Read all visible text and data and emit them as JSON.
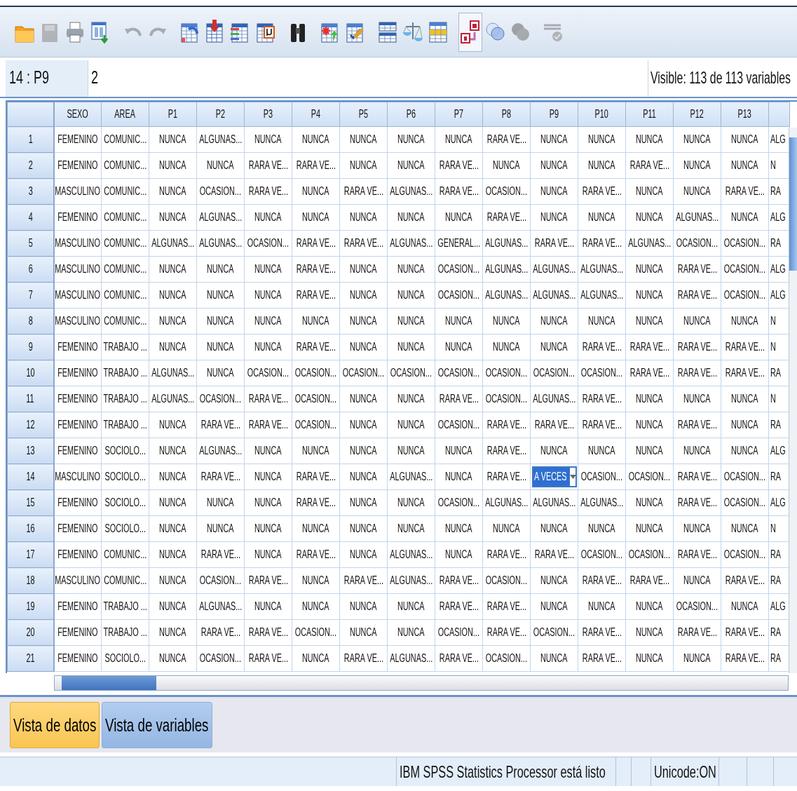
{
  "toolbar": [
    {
      "disabled": false,
      "pressed": false
    },
    {
      "disabled": true,
      "pressed": false
    },
    {
      "disabled": false,
      "pressed": false
    },
    {
      "disabled": false,
      "pressed": false
    },
    {
      "disabled": true,
      "pressed": false
    },
    {
      "disabled": true,
      "pressed": false
    },
    {
      "disabled": false,
      "pressed": false
    },
    {
      "disabled": false,
      "pressed": false
    },
    {
      "disabled": false,
      "pressed": false
    },
    {
      "disabled": false,
      "pressed": false
    },
    {
      "disabled": false,
      "pressed": false
    },
    {
      "disabled": false,
      "pressed": false
    },
    {
      "disabled": false,
      "pressed": false
    },
    {
      "disabled": false,
      "pressed": false
    },
    {
      "disabled": false,
      "pressed": false
    },
    {
      "disabled": false,
      "pressed": false
    },
    {
      "disabled": false,
      "pressed": true
    },
    {
      "disabled": false,
      "pressed": false
    },
    {
      "disabled": true,
      "pressed": false
    },
    {
      "disabled": true,
      "pressed": false
    }
  ],
  "cell_ref": "14 : P9",
  "cell_value": "2",
  "visible_info": "Visible: 113 de 113 variables",
  "columns": [
    "SEXO",
    "AREA",
    "P1",
    "P2",
    "P3",
    "P4",
    "P5",
    "P6",
    "P7",
    "P8",
    "P9",
    "P10",
    "P11",
    "P12",
    "P13"
  ],
  "rows": [
    {
      "number": "1",
      "cells": [
        "FEMENINO",
        "COMUNIC...",
        "NUNCA",
        "ALGUNAS...",
        "NUNCA",
        "NUNCA",
        "NUNCA",
        "NUNCA",
        "NUNCA",
        "RARA VE...",
        "NUNCA",
        "NUNCA",
        "NUNCA",
        "NUNCA",
        "NUNCA",
        "ALG"
      ]
    },
    {
      "number": "2",
      "cells": [
        "FEMENINO",
        "COMUNIC...",
        "NUNCA",
        "NUNCA",
        "RARA VE...",
        "RARA VE...",
        "NUNCA",
        "NUNCA",
        "RARA VE...",
        "NUNCA",
        "NUNCA",
        "NUNCA",
        "RARA VE...",
        "NUNCA",
        "NUNCA",
        "N"
      ]
    },
    {
      "number": "3",
      "cells": [
        "MASCULINO",
        "COMUNIC...",
        "NUNCA",
        "OCASION...",
        "RARA VE...",
        "NUNCA",
        "RARA VE...",
        "ALGUNAS...",
        "RARA VE...",
        "OCASION...",
        "NUNCA",
        "RARA VE...",
        "NUNCA",
        "NUNCA",
        "RARA VE...",
        "RA"
      ]
    },
    {
      "number": "4",
      "cells": [
        "FEMENINO",
        "COMUNIC...",
        "NUNCA",
        "ALGUNAS...",
        "NUNCA",
        "NUNCA",
        "NUNCA",
        "NUNCA",
        "NUNCA",
        "RARA VE...",
        "NUNCA",
        "NUNCA",
        "NUNCA",
        "ALGUNAS...",
        "NUNCA",
        "ALG"
      ]
    },
    {
      "number": "5",
      "cells": [
        "MASCULINO",
        "COMUNIC...",
        "ALGUNAS...",
        "ALGUNAS...",
        "OCASION...",
        "RARA VE...",
        "RARA VE...",
        "ALGUNAS...",
        "GENERAL...",
        "ALGUNAS...",
        "RARA VE...",
        "RARA VE...",
        "ALGUNAS...",
        "OCASION...",
        "OCASION...",
        "RA"
      ]
    },
    {
      "number": "6",
      "cells": [
        "MASCULINO",
        "COMUNIC...",
        "NUNCA",
        "NUNCA",
        "NUNCA",
        "RARA VE...",
        "NUNCA",
        "NUNCA",
        "OCASION...",
        "ALGUNAS...",
        "ALGUNAS...",
        "ALGUNAS...",
        "NUNCA",
        "RARA VE...",
        "OCASION...",
        "ALG"
      ]
    },
    {
      "number": "7",
      "cells": [
        "MASCULINO",
        "COMUNIC...",
        "NUNCA",
        "NUNCA",
        "NUNCA",
        "RARA VE...",
        "NUNCA",
        "NUNCA",
        "OCASION...",
        "ALGUNAS...",
        "ALGUNAS...",
        "ALGUNAS...",
        "NUNCA",
        "RARA VE...",
        "OCASION...",
        "ALG"
      ]
    },
    {
      "number": "8",
      "cells": [
        "MASCULINO",
        "COMUNIC...",
        "NUNCA",
        "NUNCA",
        "NUNCA",
        "NUNCA",
        "NUNCA",
        "NUNCA",
        "NUNCA",
        "NUNCA",
        "NUNCA",
        "NUNCA",
        "NUNCA",
        "NUNCA",
        "NUNCA",
        "N"
      ]
    },
    {
      "number": "9",
      "cells": [
        "FEMENINO",
        "TRABAJO ...",
        "NUNCA",
        "NUNCA",
        "NUNCA",
        "RARA VE...",
        "NUNCA",
        "NUNCA",
        "NUNCA",
        "NUNCA",
        "NUNCA",
        "RARA VE...",
        "RARA VE...",
        "RARA VE...",
        "RARA VE...",
        "N"
      ]
    },
    {
      "number": "10",
      "cells": [
        "FEMENINO",
        "TRABAJO ...",
        "ALGUNAS...",
        "NUNCA",
        "OCASION...",
        "OCASION...",
        "OCASION...",
        "OCASION...",
        "OCASION...",
        "OCASION...",
        "OCASION...",
        "OCASION...",
        "RARA VE...",
        "RARA VE...",
        "RARA VE...",
        "RA"
      ]
    },
    {
      "number": "11",
      "cells": [
        "FEMENINO",
        "TRABAJO ...",
        "ALGUNAS...",
        "OCASION...",
        "RARA VE...",
        "OCASION...",
        "NUNCA",
        "NUNCA",
        "RARA VE...",
        "OCASION...",
        "ALGUNAS...",
        "RARA VE...",
        "NUNCA",
        "NUNCA",
        "NUNCA",
        "N"
      ]
    },
    {
      "number": "12",
      "cells": [
        "FEMENINO",
        "TRABAJO ...",
        "NUNCA",
        "RARA VE...",
        "RARA VE...",
        "OCASION...",
        "NUNCA",
        "NUNCA",
        "OCASION...",
        "RARA VE...",
        "RARA VE...",
        "RARA VE...",
        "NUNCA",
        "RARA VE...",
        "NUNCA",
        "RA"
      ]
    },
    {
      "number": "13",
      "cells": [
        "FEMENINO",
        "SOCIOLO...",
        "NUNCA",
        "ALGUNAS...",
        "NUNCA",
        "NUNCA",
        "NUNCA",
        "NUNCA",
        "NUNCA",
        "RARA VE...",
        "NUNCA",
        "NUNCA",
        "NUNCA",
        "NUNCA",
        "NUNCA",
        "ALG"
      ]
    },
    {
      "number": "14",
      "cells": [
        "MASCULINO",
        "SOCIOLO...",
        "NUNCA",
        "RARA VE...",
        "NUNCA",
        "RARA VE...",
        "NUNCA",
        "ALGUNAS...",
        "NUNCA",
        "RARA VE...",
        {
          "kind": "editor",
          "value": "A VECES"
        },
        "OCASION...",
        "OCASION...",
        "RARA VE...",
        "OCASION...",
        "RA"
      ]
    },
    {
      "number": "15",
      "cells": [
        "FEMENINO",
        "SOCIOLO...",
        "NUNCA",
        "NUNCA",
        "NUNCA",
        "RARA VE...",
        "NUNCA",
        "NUNCA",
        "OCASION...",
        "ALGUNAS...",
        "ALGUNAS...",
        "ALGUNAS...",
        "NUNCA",
        "RARA VE...",
        "OCASION...",
        "ALG"
      ]
    },
    {
      "number": "16",
      "cells": [
        "FEMENINO",
        "SOCIOLO...",
        "NUNCA",
        "NUNCA",
        "NUNCA",
        "NUNCA",
        "NUNCA",
        "NUNCA",
        "NUNCA",
        "NUNCA",
        "NUNCA",
        "NUNCA",
        "NUNCA",
        "NUNCA",
        "NUNCA",
        "N"
      ]
    },
    {
      "number": "17",
      "cells": [
        "FEMENINO",
        "COMUNIC...",
        "NUNCA",
        "RARA VE...",
        "NUNCA",
        "RARA VE...",
        "NUNCA",
        "ALGUNAS...",
        "NUNCA",
        "RARA VE...",
        "RARA VE...",
        "OCASION...",
        "OCASION...",
        "RARA VE...",
        "OCASION...",
        "RA"
      ]
    },
    {
      "number": "18",
      "cells": [
        "MASCULINO",
        "COMUNIC...",
        "NUNCA",
        "OCASION...",
        "RARA VE...",
        "NUNCA",
        "RARA VE...",
        "ALGUNAS...",
        "RARA VE...",
        "OCASION...",
        "NUNCA",
        "RARA VE...",
        "RARA VE...",
        "NUNCA",
        "RARA VE...",
        "RA"
      ]
    },
    {
      "number": "19",
      "cells": [
        "FEMENINO",
        "TRABAJO ...",
        "NUNCA",
        "ALGUNAS...",
        "NUNCA",
        "NUNCA",
        "NUNCA",
        "NUNCA",
        "RARA VE...",
        "RARA VE...",
        "NUNCA",
        "NUNCA",
        "NUNCA",
        "OCASION...",
        "NUNCA",
        "ALG"
      ]
    },
    {
      "number": "20",
      "cells": [
        "FEMENINO",
        "TRABAJO ...",
        "NUNCA",
        "RARA VE...",
        "RARA VE...",
        "OCASION...",
        "NUNCA",
        "NUNCA",
        "OCASION...",
        "RARA VE...",
        "OCASION...",
        "RARA VE...",
        "NUNCA",
        "RARA VE...",
        "RARA VE...",
        "RA"
      ]
    },
    {
      "number": "21",
      "cells": [
        "FEMENINO",
        "SOCIOLO...",
        "NUNCA",
        "OCASION...",
        "RARA VE...",
        "NUNCA",
        "RARA VE...",
        "ALGUNAS...",
        "RARA VE...",
        "OCASION...",
        "NUNCA",
        "RARA VE...",
        "NUNCA",
        "NUNCA",
        "RARA VE...",
        "RA"
      ]
    }
  ],
  "tabs": [
    {
      "label": "Vista de datos",
      "selected": true
    },
    {
      "label": "Vista de variables",
      "selected": false
    }
  ],
  "status_bar": {
    "message": "IBM SPSS Statistics Processor está listo",
    "encoding": "Unicode:ON"
  }
}
